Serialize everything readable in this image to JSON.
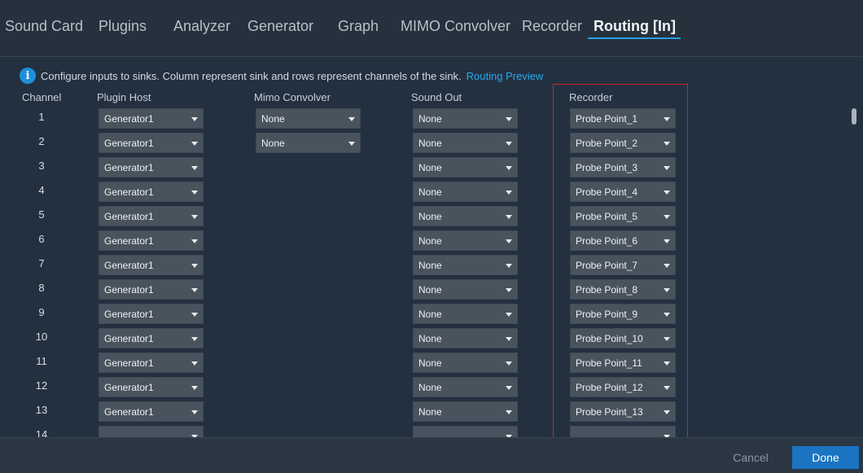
{
  "tabs": [
    {
      "label": "Sound Card",
      "active": false
    },
    {
      "label": "Plugins",
      "active": false
    },
    {
      "label": "Analyzer",
      "active": false
    },
    {
      "label": "Generator",
      "active": false
    },
    {
      "label": "Graph",
      "active": false
    },
    {
      "label": "MIMO Convolver",
      "active": false
    },
    {
      "label": "Recorder",
      "active": false
    },
    {
      "label": "Routing [In]",
      "active": true
    }
  ],
  "info": {
    "icon": "info-icon",
    "text": "Configure inputs to sinks. Column represent sink and rows represent channels of the sink.",
    "link": "Routing Preview"
  },
  "columns": {
    "channel": "Channel",
    "plugin_host": "Plugin Host",
    "mimo_convolver": "Mimo Convolver",
    "sound_out": "Sound Out",
    "recorder": "Recorder"
  },
  "rows": [
    {
      "channel": "1",
      "plugin_host": "Generator1",
      "mimo": "None",
      "sound_out": "None",
      "recorder": "Probe Point_1"
    },
    {
      "channel": "2",
      "plugin_host": "Generator1",
      "mimo": "None",
      "sound_out": "None",
      "recorder": "Probe Point_2"
    },
    {
      "channel": "3",
      "plugin_host": "Generator1",
      "sound_out": "None",
      "recorder": "Probe Point_3"
    },
    {
      "channel": "4",
      "plugin_host": "Generator1",
      "sound_out": "None",
      "recorder": "Probe Point_4"
    },
    {
      "channel": "5",
      "plugin_host": "Generator1",
      "sound_out": "None",
      "recorder": "Probe Point_5"
    },
    {
      "channel": "6",
      "plugin_host": "Generator1",
      "sound_out": "None",
      "recorder": "Probe Point_6"
    },
    {
      "channel": "7",
      "plugin_host": "Generator1",
      "sound_out": "None",
      "recorder": "Probe Point_7"
    },
    {
      "channel": "8",
      "plugin_host": "Generator1",
      "sound_out": "None",
      "recorder": "Probe Point_8"
    },
    {
      "channel": "9",
      "plugin_host": "Generator1",
      "sound_out": "None",
      "recorder": "Probe Point_9"
    },
    {
      "channel": "10",
      "plugin_host": "Generator1",
      "sound_out": "None",
      "recorder": "Probe Point_10"
    },
    {
      "channel": "11",
      "plugin_host": "Generator1",
      "sound_out": "None",
      "recorder": "Probe Point_11"
    },
    {
      "channel": "12",
      "plugin_host": "Generator1",
      "sound_out": "None",
      "recorder": "Probe Point_12"
    },
    {
      "channel": "13",
      "plugin_host": "Generator1",
      "sound_out": "None",
      "recorder": "Probe Point_13"
    },
    {
      "channel": "14",
      "plugin_host": "",
      "sound_out": "",
      "recorder": ""
    }
  ],
  "footer": {
    "cancel": "Cancel",
    "done": "Done"
  },
  "colors": {
    "accent": "#2a9fe3",
    "highlight": "#d0222b",
    "done_button": "#1a74c2"
  }
}
